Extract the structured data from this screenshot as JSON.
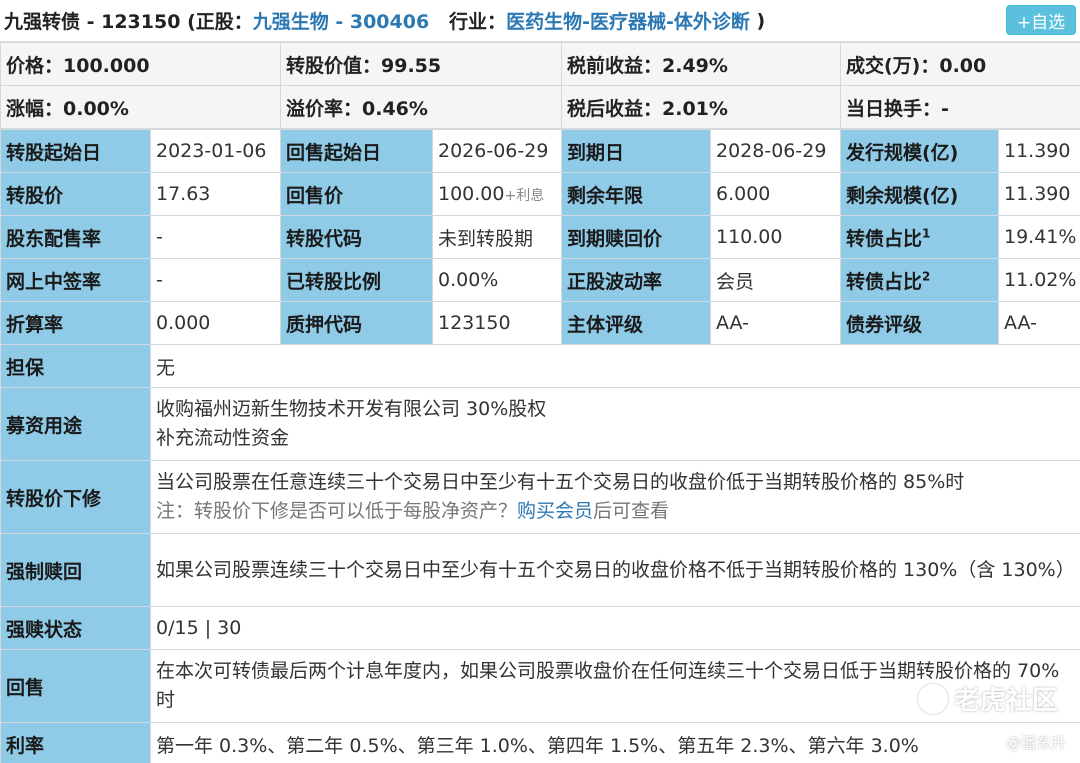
{
  "header": {
    "bond_name": "九强转债 - 123150",
    "stock_prefix": "(正股：",
    "stock_link": "九强生物 - 300406",
    "industry_prefix": "行业：",
    "industry_link": "医药生物-医疗器械-体外诊断",
    "suffix": ")",
    "favorite_label": "+自选"
  },
  "summary": [
    [
      "价格：100.000",
      "转股价值：99.55",
      "税前收益：2.49%",
      "成交(万)：0.00"
    ],
    [
      "涨幅：0.00%",
      "溢价率：0.46%",
      "税后收益：2.01%",
      "当日换手：-"
    ]
  ],
  "details": {
    "r1": [
      "转股起始日",
      "2023-01-06",
      "回售起始日",
      "2026-06-29",
      "到期日",
      "2028-06-29",
      "发行规模(亿)",
      "11.390"
    ],
    "r2": [
      "转股价",
      "17.63",
      "回售价",
      "100.00",
      "+利息",
      "剩余年限",
      "6.000",
      "剩余规模(亿)",
      "11.390"
    ],
    "r3": [
      "股东配售率",
      "-",
      "转股代码",
      "未到转股期",
      "到期赎回价",
      "110.00",
      "转债占比",
      "1",
      "19.41%"
    ],
    "r4": [
      "网上中签率",
      "-",
      "已转股比例",
      "0.00%",
      "正股波动率",
      "会员",
      "转债占比",
      "2",
      "11.02%"
    ],
    "r5": [
      "折算率",
      "0.000",
      "质押代码",
      "123150",
      "主体评级",
      "AA-",
      "债券评级",
      "AA-"
    ]
  },
  "terms": {
    "guarantee_label": "担保",
    "guarantee_value": "无",
    "use_label": "募资用途",
    "use_line1": "收购福州迈新生物技术开发有限公司 30%股权",
    "use_line2": "补充流动性资金",
    "down_label": "转股价下修",
    "down_line1": "当公司股票在任意连续三十个交易日中至少有十五个交易日的收盘价低于当期转股价格的 85%时",
    "down_note": "注：转股价下修是否可以低于每股净资产？",
    "down_link": "购买会员",
    "down_tail": "后可查看",
    "call_label": "强制赎回",
    "call_value": "如果公司股票连续三十个交易日中至少有十五个交易日的收盘价格不低于当期转股价格的 130%（含 130%）",
    "call_status_label": "强赎状态",
    "call_status_value": "0/15 | 30",
    "put_label": "回售",
    "put_value": "在本次可转债最后两个计息年度内，如果公司股票收盘价在任何连续三十个交易日低于当期转股价格的 70%时",
    "rate_label": "利率",
    "rate_value": "第一年 0.3%、第二年 0.5%、第三年 1.0%、第四年 1.5%、第五年 2.3%、第六年 3.0%"
  },
  "watermark": {
    "logo_text": "老虎社区",
    "user_text": "@潘东升"
  },
  "colors": {
    "label_bg": "#8fcbe7",
    "link": "#2c78b3",
    "alert": "#e0201e",
    "button": "#5bc0de"
  }
}
